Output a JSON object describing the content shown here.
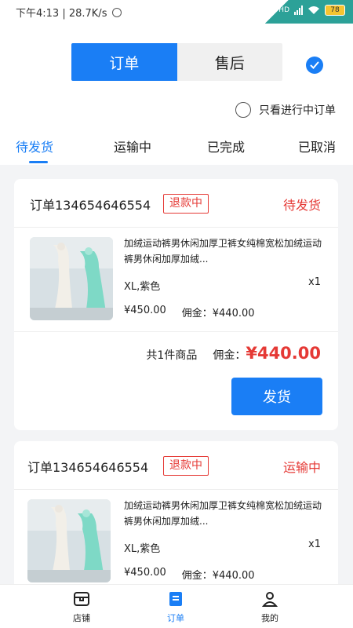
{
  "status_bar": {
    "time_speed": "下午4:13 | 28.7K/s",
    "battery": "78",
    "net_label": "HD"
  },
  "header": {
    "segments": [
      "订单",
      "售后"
    ],
    "toggle_label": "只看进行中订单",
    "tabs": [
      "待发货",
      "运输中",
      "已完成",
      "已取消"
    ],
    "active_tab": "待发货"
  },
  "orders": [
    {
      "order_no": "订单134654646554",
      "badge": "退款中",
      "status": "待发货",
      "product": {
        "title": "加绒运动裤男休闲加厚卫裤女纯棉宽松加绒运动裤男休闲加厚加绒...",
        "spec": "XL,紫色",
        "qty": "x1",
        "price": "¥450.00",
        "commission": "佣金：¥440.00"
      },
      "summary_count": "共1件商品",
      "summary_label": "佣金：",
      "summary_amount": "¥440.00",
      "action": "发货"
    },
    {
      "order_no": "订单134654646554",
      "badge": "退款中",
      "status": "运输中",
      "product": {
        "title": "加绒运动裤男休闲加厚卫裤女纯棉宽松加绒运动裤男休闲加厚加绒...",
        "spec": "XL,紫色",
        "qty": "x1",
        "price": "¥450.00",
        "commission": "佣金：¥440.00"
      }
    }
  ],
  "bottom_nav": [
    {
      "label": "店铺",
      "icon": "store-icon"
    },
    {
      "label": "订单",
      "icon": "order-icon"
    },
    {
      "label": "我的",
      "icon": "user-icon"
    }
  ],
  "colors": {
    "accent": "#1a7ef5",
    "danger": "#e53935",
    "status_teal": "#2ca198"
  }
}
